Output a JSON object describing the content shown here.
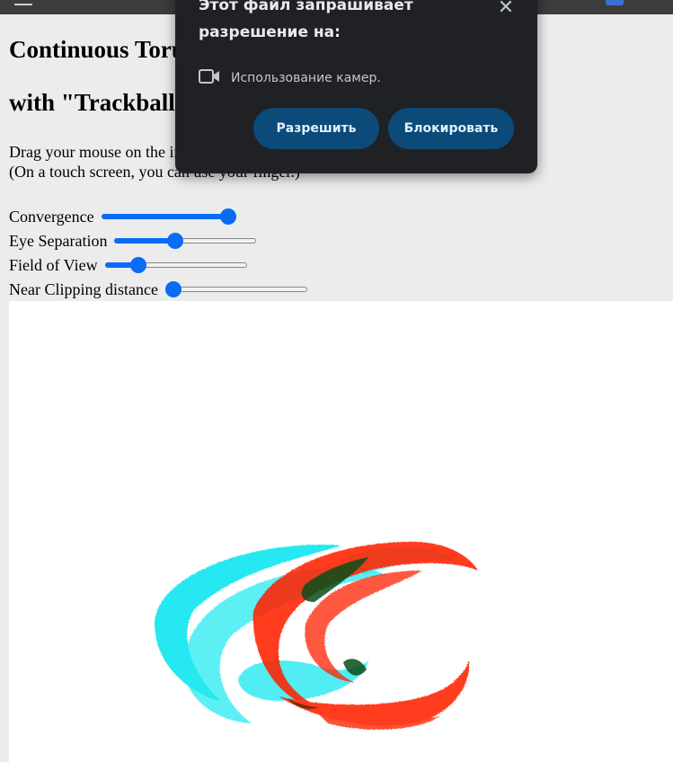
{
  "page": {
    "title_line1": "Continuous Torus",
    "title_line2": "with \"Trackball\"",
    "instruction_line1": "Drag your mouse on the image to rotate it.",
    "instruction_line2": "(On a touch screen, you can use your finger.)"
  },
  "controls": [
    {
      "label": "Convergence",
      "value_fraction": 1.0
    },
    {
      "label": "Eye Separation",
      "value_fraction": 0.42
    },
    {
      "label": "Field of View",
      "value_fraction": 0.2
    },
    {
      "label": "Near Clipping distance",
      "value_fraction": 0.0
    }
  ],
  "dialog": {
    "title": "Этот файл запрашивает разрешение на:",
    "permission_icon": "video-camera-icon",
    "permission_text": "Использование камер.",
    "allow_label": "Разрешить",
    "block_label": "Блокировать",
    "close_icon": "close-icon",
    "background_color": "#202124",
    "button_color": "#0b4a79"
  },
  "scene": {
    "description_colors": {
      "left_eye": "#00e5ee",
      "right_eye": "#ff2200"
    }
  }
}
